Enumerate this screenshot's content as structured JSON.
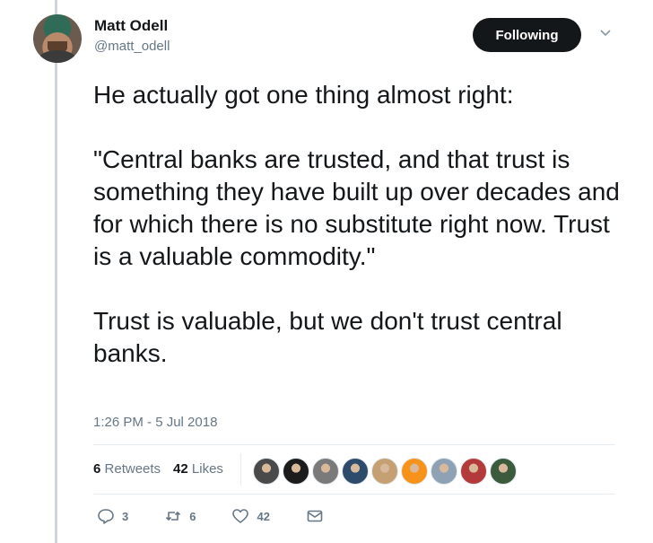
{
  "author": {
    "name": "Matt Odell",
    "handle": "@matt_odell"
  },
  "follow_button": {
    "label": "Following"
  },
  "tweet": {
    "paragraphs": [
      "He actually got one thing almost right:",
      "\"Central banks are trusted, and that trust is something they have built up over decades and for which there is no substitute right now. Trust is a valuable commodity.\"",
      "Trust is valuable, but we don't trust central banks."
    ],
    "timestamp": "1:26 PM - 5 Jul 2018"
  },
  "stats": {
    "retweets_count": "6",
    "retweets_label": "Retweets",
    "likes_count": "42",
    "likes_label": "Likes"
  },
  "liker_avatars": [
    {
      "color": "#4a4a4a"
    },
    {
      "color": "#1c1c1c"
    },
    {
      "color": "#7a7a7a"
    },
    {
      "color": "#2e4b6b"
    },
    {
      "color": "#c4a072"
    },
    {
      "color": "#f7931a"
    },
    {
      "color": "#8ea1b5"
    },
    {
      "color": "#b33a3a"
    },
    {
      "color": "#3c5a3c"
    }
  ],
  "actions": {
    "reply_count": "3",
    "retweet_count": "6",
    "like_count": "42"
  },
  "icons": [
    "reply-icon",
    "retweet-icon",
    "like-icon",
    "message-icon",
    "chevron-down-icon"
  ],
  "colors": {
    "text": "#14171a",
    "secondary": "#657786",
    "button_bg": "#14171a"
  }
}
